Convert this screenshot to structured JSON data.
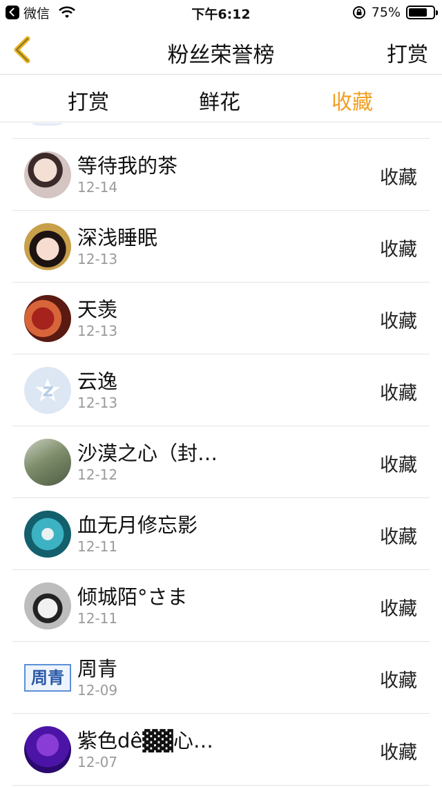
{
  "status_bar": {
    "app_back_label": "微信",
    "time": "下午6:12",
    "battery_pct": "75%",
    "battery_level": 0.75
  },
  "nav": {
    "title": "粉丝荣誉榜",
    "action": "打赏"
  },
  "tabs": [
    {
      "label": "打赏",
      "active": false
    },
    {
      "label": "鲜花",
      "active": false
    },
    {
      "label": "收藏",
      "active": true
    }
  ],
  "colors": {
    "accent": "#f0a020",
    "date_gray": "#9a9a9a",
    "divider": "#e4e4e4"
  },
  "list": [
    {
      "name": "等待我的茶",
      "date": "12-14",
      "action": "收藏",
      "avatar": "avatar-anime-man"
    },
    {
      "name": "深浅睡眠",
      "date": "12-13",
      "action": "收藏",
      "avatar": "avatar-costume-woman"
    },
    {
      "name": "天羡",
      "date": "12-13",
      "action": "收藏",
      "avatar": "avatar-red-art"
    },
    {
      "name": "云逸",
      "date": "12-13",
      "action": "收藏",
      "avatar": "avatar-default-qq"
    },
    {
      "name": "沙漠之心（封…",
      "date": "12-12",
      "action": "收藏",
      "avatar": "avatar-outdoor-girl"
    },
    {
      "name": "血无月修忘影",
      "date": "12-11",
      "action": "收藏",
      "avatar": "avatar-teal-art"
    },
    {
      "name": "倾城陌°さま",
      "date": "12-11",
      "action": "收藏",
      "avatar": "avatar-monochrome-anime"
    },
    {
      "name": "周青",
      "date": "12-09",
      "action": "收藏",
      "avatar": "avatar-zhouqing-text",
      "avatar_text": "周青"
    },
    {
      "name": "紫色dê▓▓心…",
      "date": "12-07",
      "action": "收藏",
      "avatar": "avatar-purple-text"
    }
  ]
}
